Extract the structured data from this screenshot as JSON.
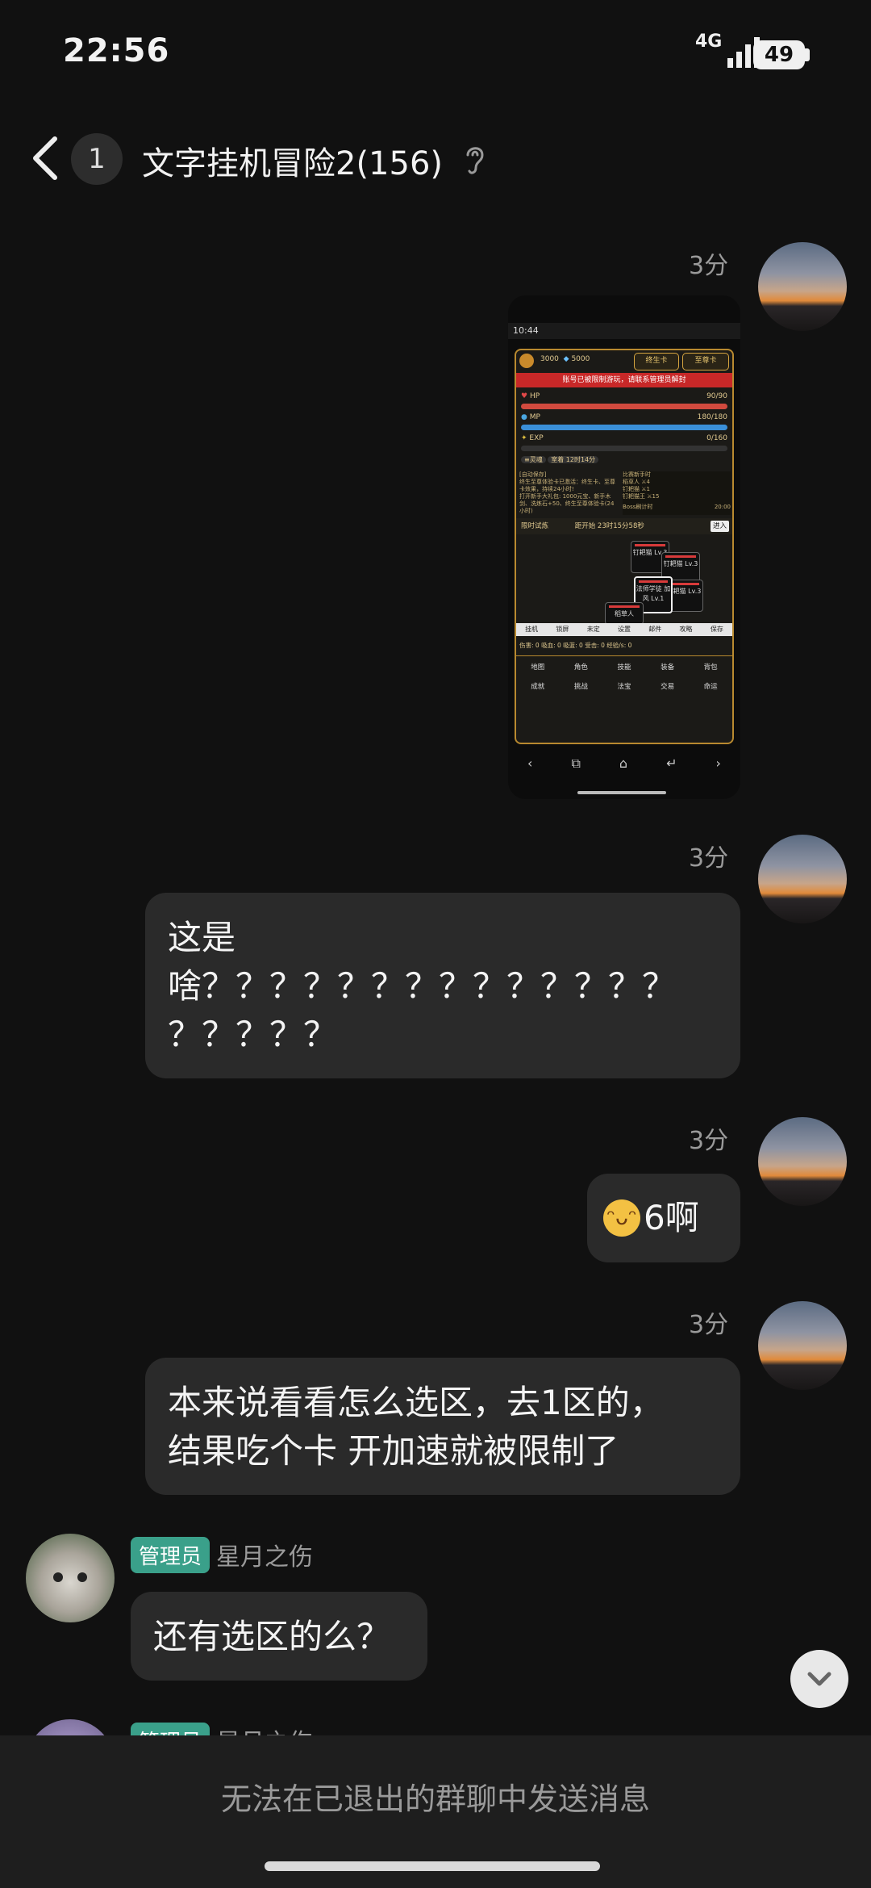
{
  "status_bar": {
    "time": "22:56",
    "network": "4G",
    "battery": "49"
  },
  "header": {
    "unread_count": "1",
    "title": "文字挂机冒险2(156)",
    "back_icon": "chevron-left-icon",
    "mode_icon": "ear-icon"
  },
  "messages": [
    {
      "time": "3分",
      "type": "image"
    },
    {
      "time": "3分",
      "line1": "这是",
      "line2": "啥？？？？？？？？？？？？？？",
      "line3": "？？？？？"
    },
    {
      "time": "3分",
      "text": "6啊",
      "emoji": "grin-emoji"
    },
    {
      "time": "3分",
      "line1": "本来说看看怎么选区，去1区的，",
      "line2": "结果吃个卡 开加速就被限制了"
    },
    {
      "badge": "管理员",
      "nickname": "星月之伤",
      "text": "还有选区的么？"
    },
    {
      "badge": "管理员",
      "nickname": "星月之伤"
    }
  ],
  "game_screenshot": {
    "status_time": "10:44",
    "gold": "3000",
    "diamonds": "5000",
    "btn_lifetime": "终生卡",
    "btn_supreme": "至尊卡",
    "warning": "账号已被限制游玩，请联系管理员解封",
    "hp_label": "HP",
    "hp_value": "90/90",
    "mp_label": "MP",
    "mp_value": "180/180",
    "exp_label": "EXP",
    "exp_value": "0/160",
    "tag1": "≡灵魂",
    "tag2": "室着 12时14分",
    "log1": "[自动保存]",
    "log2": "终生至尊体验卡已激活：终生卡、至尊卡效果，持续24小时!",
    "log3": "打开新手大礼包: 1000元宝、新手木剑、洗炼石+50、终生至尊体验卡(24小时)",
    "side_title": "比赛新手时",
    "side1": "稻草人 ⚔4",
    "side2": "钉耙猫 ⚔1",
    "side3": "钉耙猫王 ⚔15",
    "boss_timer_label": "Boss刷计时",
    "boss_timer": "20:00",
    "trial": "限时试炼",
    "trial_timer": "距开始 23时15分58秒",
    "enter": "进入",
    "cards": [
      "钉耙猫 Lv.3",
      "钉耙猫 Lv.3",
      "法师学徒 加风 Lv.1",
      "钉耙猫 Lv.3",
      "稻草人"
    ],
    "actions": [
      "挂机",
      "锁屏",
      "未定",
      "设置",
      "邮件",
      "攻略",
      "保存"
    ],
    "stats": "伤害: 0  吸血: 0  吸蓝: 0  受击: 0  经验/s: 0",
    "nav_row1": [
      "地图",
      "角色",
      "技能",
      "装备",
      "背包"
    ],
    "nav_row2": [
      "成就",
      "挑战",
      "法宝",
      "交易",
      "命运"
    ]
  },
  "footer": {
    "notice": "无法在已退出的群聊中发送消息"
  },
  "colors": {
    "background": "#111111",
    "bubble": "#2a2a2a",
    "admin_badge": "#3aa08a"
  }
}
